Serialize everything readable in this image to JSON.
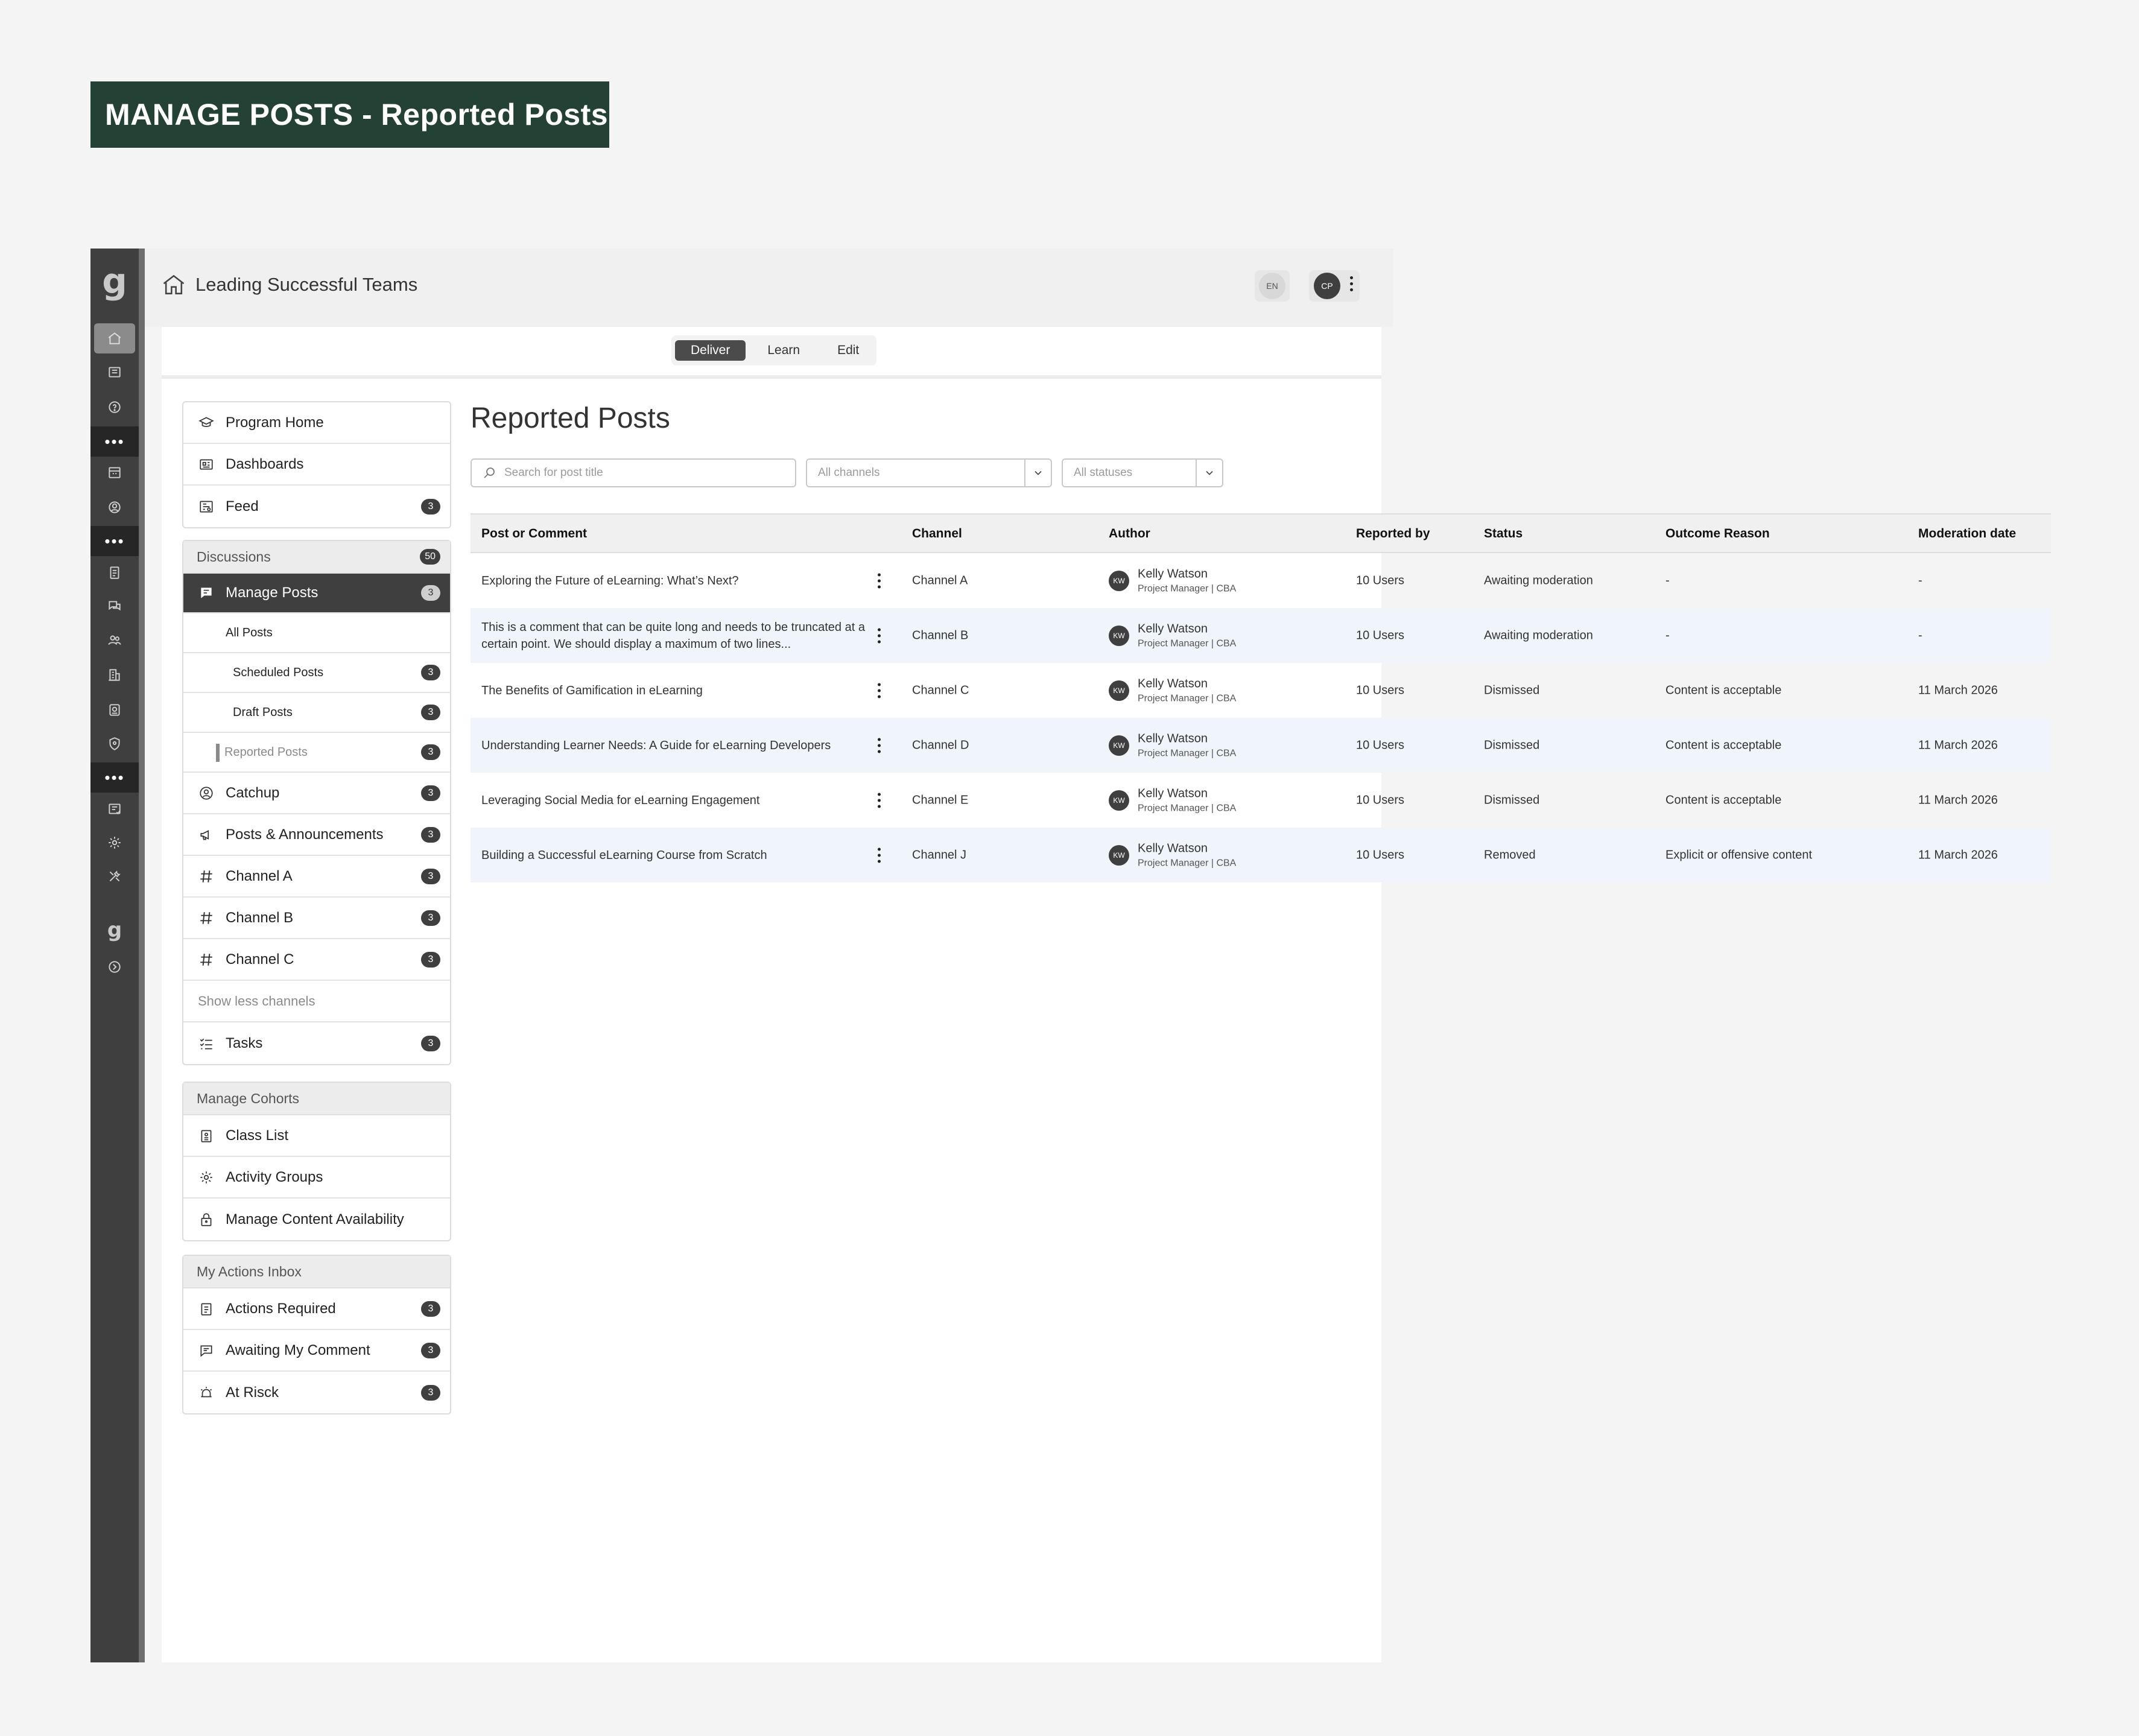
{
  "banner": {
    "title": "MANAGE POSTS - Reported Posts"
  },
  "rail": {
    "logo": "g",
    "logo_small": "g",
    "dots": "•••"
  },
  "header": {
    "app_title": "Leading Successful Teams",
    "lang_chip": "EN",
    "user_chip": "CP"
  },
  "tabs": [
    "Deliver",
    "Learn",
    "Edit"
  ],
  "sidenav": {
    "top_items": [
      {
        "label": "Program Home",
        "icon": "graduation-cap-icon"
      },
      {
        "label": "Dashboards",
        "icon": "dashboard-icon"
      },
      {
        "label": "Feed",
        "icon": "feed-icon",
        "badge": "3"
      }
    ],
    "discussions": {
      "header": "Discussions",
      "badge": "50",
      "manage_posts": {
        "label": "Manage Posts",
        "badge": "3"
      },
      "all_posts": "All Posts",
      "scheduled": {
        "label": "Scheduled Posts",
        "badge": "3"
      },
      "drafts": {
        "label": "Draft Posts",
        "badge": "3"
      },
      "reported": {
        "label": "Reported Posts",
        "badge": "3"
      },
      "items": [
        {
          "label": "Catchup",
          "badge": "3"
        },
        {
          "label": "Posts & Announcements",
          "badge": "3"
        },
        {
          "label": "Channel A",
          "badge": "3"
        },
        {
          "label": "Channel B",
          "badge": "3"
        },
        {
          "label": "Channel C",
          "badge": "3"
        }
      ],
      "show_less": "Show less channels",
      "tasks": {
        "label": "Tasks",
        "badge": "3"
      }
    },
    "cohorts": {
      "header": "Manage Cohorts",
      "items": [
        "Class List",
        "Activity Groups",
        "Manage Content Availability"
      ]
    },
    "inbox": {
      "header": "My Actions Inbox",
      "items": [
        {
          "label": "Actions Required",
          "badge": "3"
        },
        {
          "label": "Awaiting My Comment",
          "badge": "3"
        },
        {
          "label": "At Risck",
          "badge": "3"
        }
      ]
    }
  },
  "main": {
    "title": "Reported Posts",
    "search_placeholder": "Search for post title",
    "channel_filter": "All channels",
    "status_filter": "All statuses",
    "columns": [
      "Post or Comment",
      "Channel",
      "Author",
      "Reported by",
      "Status",
      "Outcome Reason",
      "Moderation date"
    ],
    "rows": [
      {
        "post": "Exploring the Future of eLearning: What’s Next?",
        "channel": "Channel A",
        "initials": "KW",
        "author": "Kelly Watson",
        "role": "Project Manager | CBA",
        "reported_by": "10 Users",
        "status": "Awaiting moderation",
        "reason": "-",
        "date": "-"
      },
      {
        "post": "This is a comment that can be quite long and needs to be truncated at a certain point. We should display a maximum of two lines...",
        "channel": "Channel B",
        "initials": "KW",
        "author": "Kelly Watson",
        "role": "Project Manager | CBA",
        "reported_by": "10 Users",
        "status": "Awaiting moderation",
        "reason": "-",
        "date": "-"
      },
      {
        "post": "The Benefits of Gamification in eLearning",
        "channel": "Channel C",
        "initials": "KW",
        "author": "Kelly Watson",
        "role": "Project Manager | CBA",
        "reported_by": "10 Users",
        "status": "Dismissed",
        "reason": "Content is acceptable",
        "date": "11 March 2026"
      },
      {
        "post": "Understanding Learner Needs: A Guide for eLearning Developers",
        "channel": "Channel D",
        "initials": "KW",
        "author": "Kelly Watson",
        "role": "Project Manager | CBA",
        "reported_by": "10 Users",
        "status": "Dismissed",
        "reason": "Content is acceptable",
        "date": "11 March 2026"
      },
      {
        "post": "Leveraging Social Media for eLearning Engagement",
        "channel": "Channel E",
        "initials": "KW",
        "author": "Kelly Watson",
        "role": "Project Manager | CBA",
        "reported_by": "10 Users",
        "status": "Dismissed",
        "reason": "Content is acceptable",
        "date": "11 March 2026"
      },
      {
        "post": "Building a Successful eLearning Course from Scratch",
        "channel": "Channel J",
        "initials": "KW",
        "author": "Kelly Watson",
        "role": "Project Manager | CBA",
        "reported_by": "10 Users",
        "status": "Removed",
        "reason": "Explicit or offensive content",
        "date": "11 March 2026"
      }
    ]
  },
  "colors": {
    "banner": "#234235",
    "rail": "#3f3f3f",
    "selected": "#3f3f3f",
    "row_alt": "#f0f5fb"
  }
}
